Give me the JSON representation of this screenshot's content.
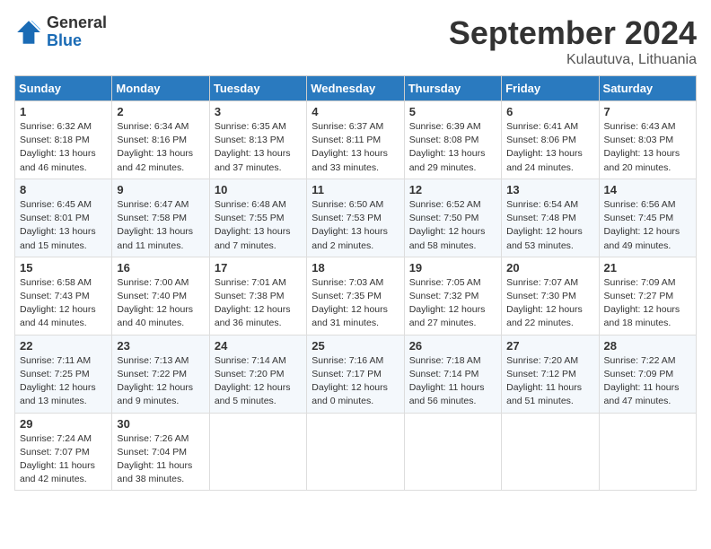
{
  "logo": {
    "general": "General",
    "blue": "Blue"
  },
  "title": "September 2024",
  "location": "Kulautuva, Lithuania",
  "weekdays": [
    "Sunday",
    "Monday",
    "Tuesday",
    "Wednesday",
    "Thursday",
    "Friday",
    "Saturday"
  ],
  "weeks": [
    [
      {
        "day": "1",
        "sunrise": "6:32 AM",
        "sunset": "8:18 PM",
        "daylight": "13 hours and 46 minutes."
      },
      {
        "day": "2",
        "sunrise": "6:34 AM",
        "sunset": "8:16 PM",
        "daylight": "13 hours and 42 minutes."
      },
      {
        "day": "3",
        "sunrise": "6:35 AM",
        "sunset": "8:13 PM",
        "daylight": "13 hours and 37 minutes."
      },
      {
        "day": "4",
        "sunrise": "6:37 AM",
        "sunset": "8:11 PM",
        "daylight": "13 hours and 33 minutes."
      },
      {
        "day": "5",
        "sunrise": "6:39 AM",
        "sunset": "8:08 PM",
        "daylight": "13 hours and 29 minutes."
      },
      {
        "day": "6",
        "sunrise": "6:41 AM",
        "sunset": "8:06 PM",
        "daylight": "13 hours and 24 minutes."
      },
      {
        "day": "7",
        "sunrise": "6:43 AM",
        "sunset": "8:03 PM",
        "daylight": "13 hours and 20 minutes."
      }
    ],
    [
      {
        "day": "8",
        "sunrise": "6:45 AM",
        "sunset": "8:01 PM",
        "daylight": "13 hours and 15 minutes."
      },
      {
        "day": "9",
        "sunrise": "6:47 AM",
        "sunset": "7:58 PM",
        "daylight": "13 hours and 11 minutes."
      },
      {
        "day": "10",
        "sunrise": "6:48 AM",
        "sunset": "7:55 PM",
        "daylight": "13 hours and 7 minutes."
      },
      {
        "day": "11",
        "sunrise": "6:50 AM",
        "sunset": "7:53 PM",
        "daylight": "13 hours and 2 minutes."
      },
      {
        "day": "12",
        "sunrise": "6:52 AM",
        "sunset": "7:50 PM",
        "daylight": "12 hours and 58 minutes."
      },
      {
        "day": "13",
        "sunrise": "6:54 AM",
        "sunset": "7:48 PM",
        "daylight": "12 hours and 53 minutes."
      },
      {
        "day": "14",
        "sunrise": "6:56 AM",
        "sunset": "7:45 PM",
        "daylight": "12 hours and 49 minutes."
      }
    ],
    [
      {
        "day": "15",
        "sunrise": "6:58 AM",
        "sunset": "7:43 PM",
        "daylight": "12 hours and 44 minutes."
      },
      {
        "day": "16",
        "sunrise": "7:00 AM",
        "sunset": "7:40 PM",
        "daylight": "12 hours and 40 minutes."
      },
      {
        "day": "17",
        "sunrise": "7:01 AM",
        "sunset": "7:38 PM",
        "daylight": "12 hours and 36 minutes."
      },
      {
        "day": "18",
        "sunrise": "7:03 AM",
        "sunset": "7:35 PM",
        "daylight": "12 hours and 31 minutes."
      },
      {
        "day": "19",
        "sunrise": "7:05 AM",
        "sunset": "7:32 PM",
        "daylight": "12 hours and 27 minutes."
      },
      {
        "day": "20",
        "sunrise": "7:07 AM",
        "sunset": "7:30 PM",
        "daylight": "12 hours and 22 minutes."
      },
      {
        "day": "21",
        "sunrise": "7:09 AM",
        "sunset": "7:27 PM",
        "daylight": "12 hours and 18 minutes."
      }
    ],
    [
      {
        "day": "22",
        "sunrise": "7:11 AM",
        "sunset": "7:25 PM",
        "daylight": "12 hours and 13 minutes."
      },
      {
        "day": "23",
        "sunrise": "7:13 AM",
        "sunset": "7:22 PM",
        "daylight": "12 hours and 9 minutes."
      },
      {
        "day": "24",
        "sunrise": "7:14 AM",
        "sunset": "7:20 PM",
        "daylight": "12 hours and 5 minutes."
      },
      {
        "day": "25",
        "sunrise": "7:16 AM",
        "sunset": "7:17 PM",
        "daylight": "12 hours and 0 minutes."
      },
      {
        "day": "26",
        "sunrise": "7:18 AM",
        "sunset": "7:14 PM",
        "daylight": "11 hours and 56 minutes."
      },
      {
        "day": "27",
        "sunrise": "7:20 AM",
        "sunset": "7:12 PM",
        "daylight": "11 hours and 51 minutes."
      },
      {
        "day": "28",
        "sunrise": "7:22 AM",
        "sunset": "7:09 PM",
        "daylight": "11 hours and 47 minutes."
      }
    ],
    [
      {
        "day": "29",
        "sunrise": "7:24 AM",
        "sunset": "7:07 PM",
        "daylight": "11 hours and 42 minutes."
      },
      {
        "day": "30",
        "sunrise": "7:26 AM",
        "sunset": "7:04 PM",
        "daylight": "11 hours and 38 minutes."
      },
      null,
      null,
      null,
      null,
      null
    ]
  ],
  "labels": {
    "sunrise": "Sunrise: ",
    "sunset": "Sunset: ",
    "daylight": "Daylight: "
  }
}
